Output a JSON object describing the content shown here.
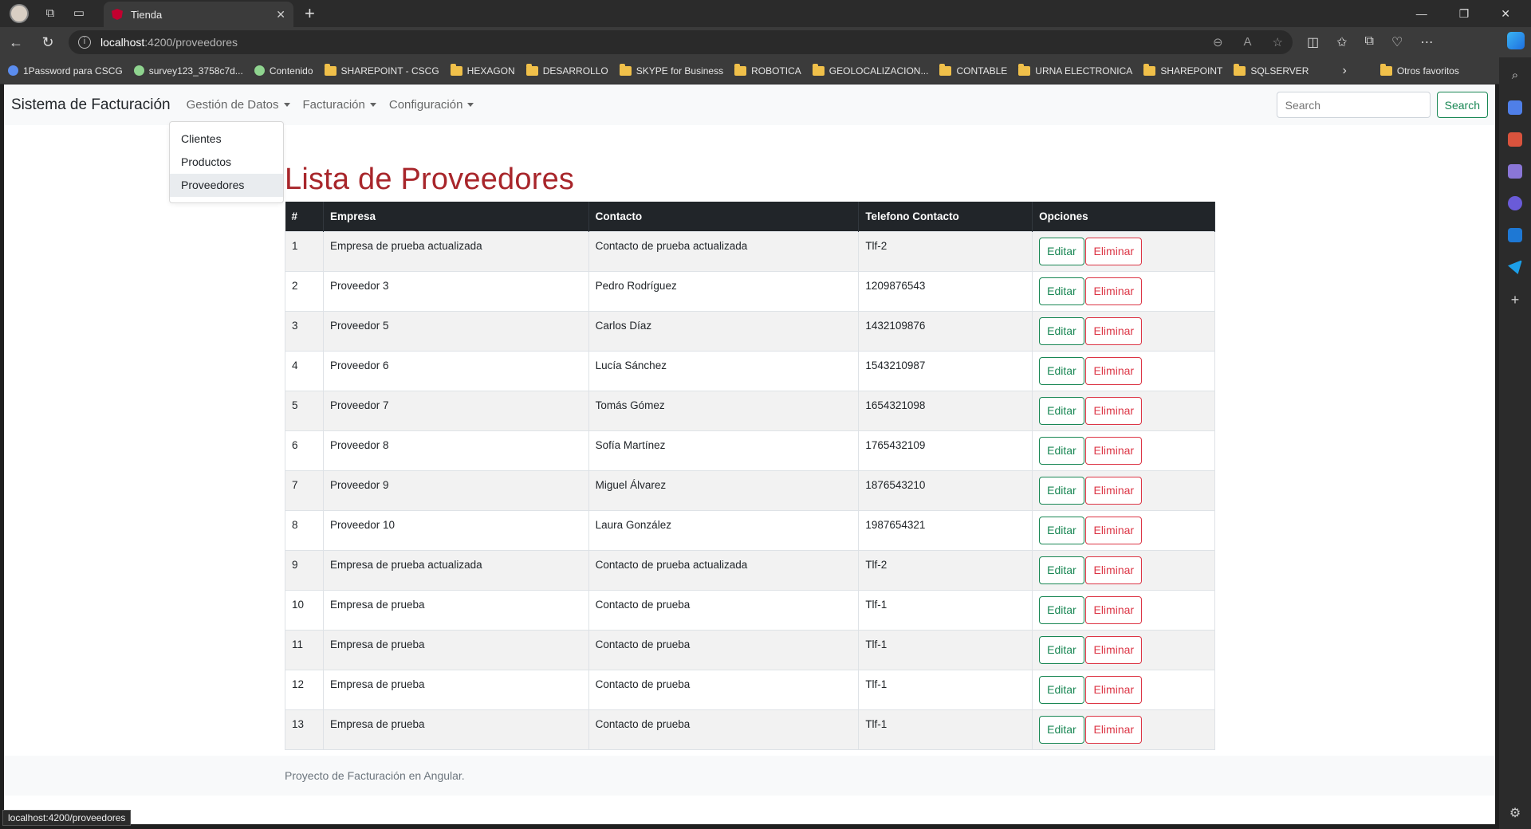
{
  "browser": {
    "tab_title": "Tienda",
    "url_host": "localhost",
    "url_path": ":4200/proveedores",
    "status_url": "localhost:4200/proveedores",
    "bookmarks": [
      {
        "label": "1Password para CSCG",
        "type": "site"
      },
      {
        "label": "survey123_3758c7d...",
        "type": "site"
      },
      {
        "label": "Contenido",
        "type": "site"
      },
      {
        "label": "SHAREPOINT - CSCG",
        "type": "folder"
      },
      {
        "label": "HEXAGON",
        "type": "folder"
      },
      {
        "label": "DESARROLLO",
        "type": "folder"
      },
      {
        "label": "SKYPE for Business",
        "type": "folder"
      },
      {
        "label": "ROBOTICA",
        "type": "folder"
      },
      {
        "label": "GEOLOCALIZACION...",
        "type": "folder"
      },
      {
        "label": "CONTABLE",
        "type": "folder"
      },
      {
        "label": "URNA ELECTRONICA",
        "type": "folder"
      },
      {
        "label": "SHAREPOINT",
        "type": "folder"
      },
      {
        "label": "SQLSERVER",
        "type": "folder"
      }
    ],
    "other_favorites": "Otros favoritos"
  },
  "navbar": {
    "brand": "Sistema de Facturación",
    "menus": [
      "Gestión de Datos",
      "Facturación",
      "Configuración"
    ],
    "search_placeholder": "Search",
    "search_button": "Search"
  },
  "dropdown": {
    "items": [
      "Clientes",
      "Productos",
      "Proveedores"
    ],
    "active": "Proveedores"
  },
  "main": {
    "title": "Lista de Proveedores",
    "columns": [
      "#",
      "Empresa",
      "Contacto",
      "Telefono Contacto",
      "Opciones"
    ],
    "edit_label": "Editar",
    "delete_label": "Eliminar",
    "rows": [
      {
        "id": "1",
        "empresa": "Empresa de prueba actualizada",
        "contacto": "Contacto de prueba actualizada",
        "telefono": "Tlf-2"
      },
      {
        "id": "2",
        "empresa": "Proveedor 3",
        "contacto": "Pedro Rodríguez",
        "telefono": "1209876543"
      },
      {
        "id": "3",
        "empresa": "Proveedor 5",
        "contacto": "Carlos Díaz",
        "telefono": "1432109876"
      },
      {
        "id": "4",
        "empresa": "Proveedor 6",
        "contacto": "Lucía Sánchez",
        "telefono": "1543210987"
      },
      {
        "id": "5",
        "empresa": "Proveedor 7",
        "contacto": "Tomás Gómez",
        "telefono": "1654321098"
      },
      {
        "id": "6",
        "empresa": "Proveedor 8",
        "contacto": "Sofía Martínez",
        "telefono": "1765432109"
      },
      {
        "id": "7",
        "empresa": "Proveedor 9",
        "contacto": "Miguel Álvarez",
        "telefono": "1876543210"
      },
      {
        "id": "8",
        "empresa": "Proveedor 10",
        "contacto": "Laura González",
        "telefono": "1987654321"
      },
      {
        "id": "9",
        "empresa": "Empresa de prueba actualizada",
        "contacto": "Contacto de prueba actualizada",
        "telefono": "Tlf-2"
      },
      {
        "id": "10",
        "empresa": "Empresa de prueba",
        "contacto": "Contacto de prueba",
        "telefono": "Tlf-1"
      },
      {
        "id": "11",
        "empresa": "Empresa de prueba",
        "contacto": "Contacto de prueba",
        "telefono": "Tlf-1"
      },
      {
        "id": "12",
        "empresa": "Empresa de prueba",
        "contacto": "Contacto de prueba",
        "telefono": "Tlf-1"
      },
      {
        "id": "13",
        "empresa": "Empresa de prueba",
        "contacto": "Contacto de prueba",
        "telefono": "Tlf-1"
      }
    ]
  },
  "footer": {
    "text": "Proyecto de Facturación en Angular."
  },
  "colors": {
    "title": "#a8262b",
    "success": "#198754",
    "danger": "#dc3545",
    "table_header": "#212529"
  }
}
